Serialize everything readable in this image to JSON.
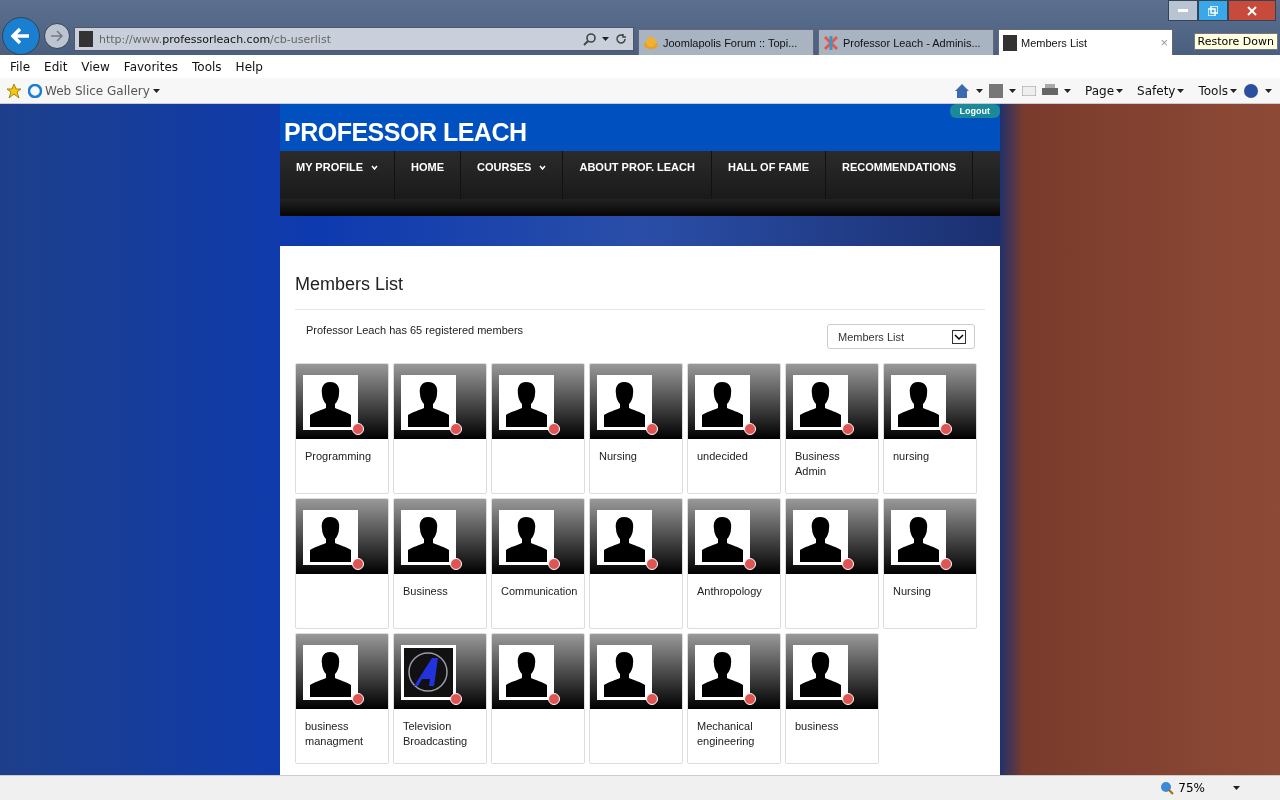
{
  "browser": {
    "url_plain": "http://www.",
    "url_domain": "professorleach.com",
    "url_path": "/cb-userlist",
    "tabs": [
      {
        "label": "Joomlapolis Forum :: Topi...",
        "selected": false
      },
      {
        "label": "Professor Leach - Adminis...",
        "selected": false
      },
      {
        "label": "Members List",
        "selected": true
      }
    ],
    "tab_close": "×",
    "tooltip": "Restore Down",
    "menu": [
      "File",
      "Edit",
      "View",
      "Favorites",
      "Tools",
      "Help"
    ],
    "favorites_link": "Web Slice Gallery",
    "commands": [
      "Page",
      "Safety",
      "Tools"
    ],
    "zoom": "75%"
  },
  "site": {
    "title": "PROFESSOR LEACH",
    "logout": "Logout",
    "nav": [
      {
        "label": "MY PROFILE",
        "has_menu": true
      },
      {
        "label": "HOME",
        "has_menu": false
      },
      {
        "label": "COURSES",
        "has_menu": true
      },
      {
        "label": "ABOUT PROF. LEACH",
        "has_menu": false
      },
      {
        "label": "HALL OF FAME",
        "has_menu": false
      },
      {
        "label": "RECOMMENDATIONS",
        "has_menu": false
      }
    ]
  },
  "page": {
    "heading": "Members List",
    "summary": "Professor Leach has 65 registered members",
    "list_select": "Members List",
    "members": [
      {
        "kind": "silhouette",
        "online": false,
        "field": "Programming"
      },
      {
        "kind": "silhouette",
        "online": false
      },
      {
        "kind": "silhouette",
        "online": false
      },
      {
        "kind": "silhouette",
        "online": false,
        "field": "Nursing"
      },
      {
        "kind": "silhouette",
        "online": false,
        "field": "undecided"
      },
      {
        "kind": "silhouette",
        "online": false,
        "field": "Business Admin"
      },
      {
        "kind": "silhouette",
        "online": false,
        "field": "nursing"
      },
      {
        "kind": "silhouette",
        "online": false
      },
      {
        "kind": "silhouette",
        "online": false,
        "field": "Business"
      },
      {
        "kind": "silhouette",
        "online": false,
        "field": "Communication"
      },
      {
        "kind": "silhouette",
        "online": false
      },
      {
        "kind": "silhouette",
        "online": false,
        "field": "Anthropology"
      },
      {
        "kind": "silhouette",
        "online": false
      },
      {
        "kind": "silhouette",
        "online": false,
        "field": "Nursing"
      },
      {
        "kind": "silhouette",
        "online": false,
        "field": "business managment"
      },
      {
        "kind": "logo",
        "online": false,
        "field": "Television Broadcasting"
      },
      {
        "kind": "silhouette",
        "online": false
      },
      {
        "kind": "silhouette",
        "online": false
      },
      {
        "kind": "silhouette",
        "online": false,
        "field": "Mechanical engineering"
      },
      {
        "kind": "silhouette",
        "online": false,
        "field": "business"
      }
    ]
  }
}
